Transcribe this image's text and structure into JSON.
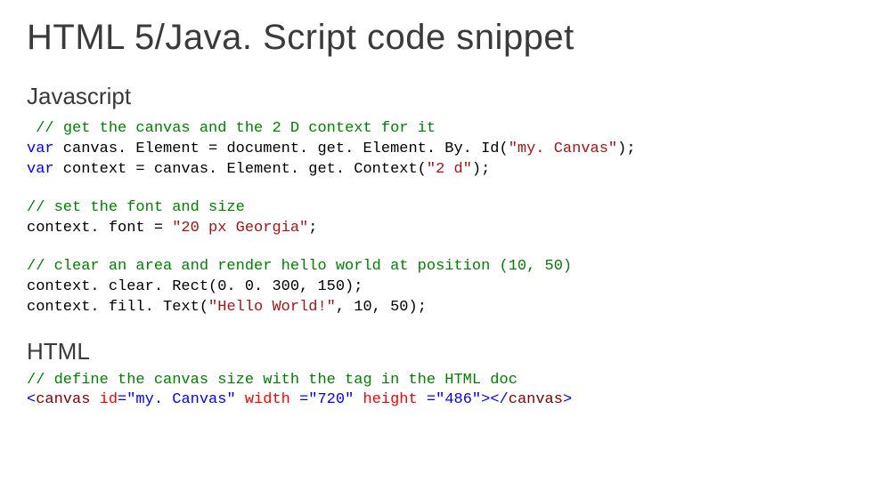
{
  "title": "HTML 5/Java. Script code snippet",
  "sections": {
    "js_heading": "Javascript",
    "html_heading": "HTML"
  },
  "code": {
    "js1": {
      "c1a": " // ",
      "c1b": "get the canvas and the 2 D context for it",
      "kw_var1": "var",
      "line2": " canvas. Element = document. get. Element. By. Id(",
      "str1": "\"my. Canvas\"",
      "line2b": ");",
      "kw_var2": "var",
      "line3": " context = canvas. Element. get. Context(",
      "str2": "\"2 d\"",
      "line3b": ");"
    },
    "js2": {
      "c1": "// set the font and size",
      "line2a": "context. font = ",
      "str1": "\"20 px Georgia\"",
      "line2b": ";"
    },
    "js3": {
      "c1": "// clear an area and render hello world at position (10, 50)",
      "line2": "context. clear. Rect(0. 0. 300, 150);",
      "line3a": "context. fill. Text(",
      "str1": "\"Hello World!\"",
      "line3b": ", 10, 50);"
    },
    "html": {
      "c1": "// define the canvas size with the tag in the HTML doc",
      "lt1": "<",
      "tag1": "canvas",
      "sp1": " ",
      "attr1": "id",
      "eq1": "=",
      "val1": "\"my. Canvas\"",
      "sp2": " ",
      "attr2": "width",
      "eq2": " =",
      "val2": "\"720\"",
      "sp3": " ",
      "attr3": "height",
      "eq3": " =",
      "val3": "\"486\"",
      "gt1": "></",
      "tag2": "canvas",
      "gt2": ">"
    }
  }
}
